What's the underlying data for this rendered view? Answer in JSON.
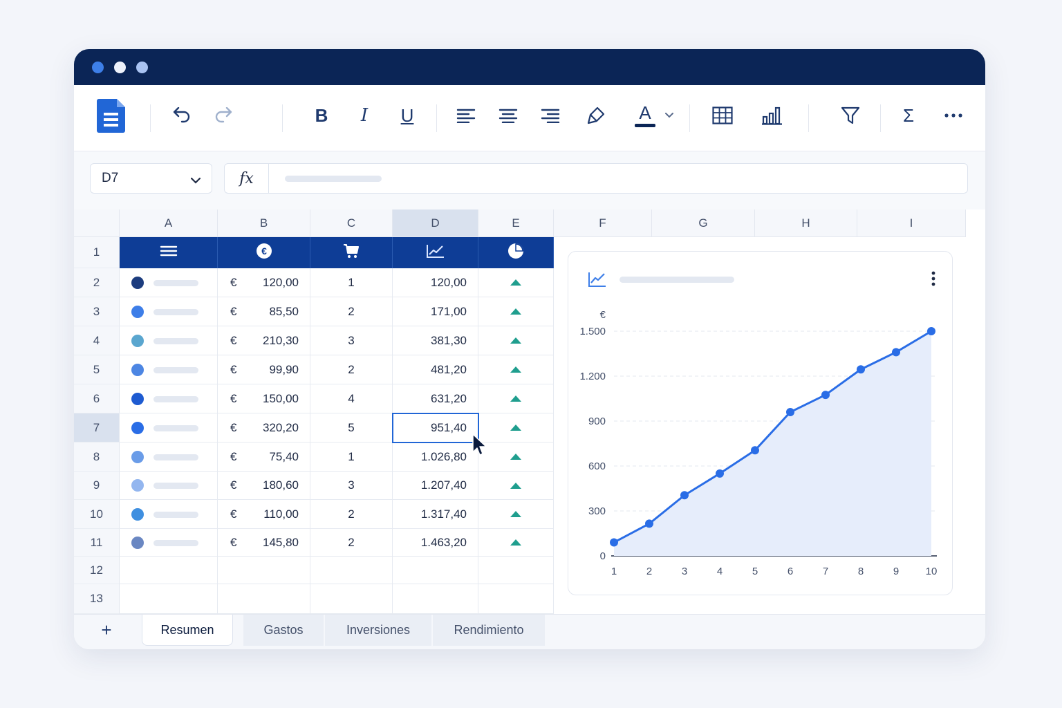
{
  "namebox": {
    "value": "D7"
  },
  "formula": {
    "label": "fx"
  },
  "toolbar": {
    "bold": "B",
    "italic": "I",
    "underline": "U",
    "font_color": "A",
    "sum": "Σ"
  },
  "columns": [
    "A",
    "B",
    "C",
    "D",
    "E",
    "F",
    "G",
    "H",
    "I"
  ],
  "rows": [
    "1",
    "2",
    "3",
    "4",
    "5",
    "6",
    "7",
    "8",
    "9",
    "10",
    "11",
    "12",
    "13"
  ],
  "header_icons": [
    "menu-icon",
    "euro-icon",
    "cart-icon",
    "trend-icon",
    "pie-icon"
  ],
  "table": [
    {
      "dot_color": "#1c3c7e",
      "currency": "€",
      "price": "120,00",
      "qty": "1",
      "total": "120,00"
    },
    {
      "dot_color": "#3d7ee8",
      "currency": "€",
      "price": "85,50",
      "qty": "2",
      "total": "171,00"
    },
    {
      "dot_color": "#5aa6cf",
      "currency": "€",
      "price": "210,30",
      "qty": "3",
      "total": "381,30"
    },
    {
      "dot_color": "#4d86e3",
      "currency": "€",
      "price": "99,90",
      "qty": "2",
      "total": "481,20"
    },
    {
      "dot_color": "#1e5bd1",
      "currency": "€",
      "price": "150,00",
      "qty": "4",
      "total": "631,20"
    },
    {
      "dot_color": "#2a6de6",
      "currency": "€",
      "price": "320,20",
      "qty": "5",
      "total": "951,40"
    },
    {
      "dot_color": "#6a9ce8",
      "currency": "€",
      "price": "75,40",
      "qty": "1",
      "total": "1.026,80"
    },
    {
      "dot_color": "#93b6ef",
      "currency": "€",
      "price": "180,60",
      "qty": "3",
      "total": "1.207,40"
    },
    {
      "dot_color": "#3f8fe0",
      "currency": "€",
      "price": "110,00",
      "qty": "2",
      "total": "1.317,40"
    },
    {
      "dot_color": "#6a87c2",
      "currency": "€",
      "price": "145,80",
      "qty": "2",
      "total": "1.463,20"
    }
  ],
  "selected_cell": "D7",
  "chart_data": {
    "type": "area",
    "title": "",
    "ylabel": "€",
    "xlabel": "",
    "x": [
      1,
      2,
      3,
      4,
      5,
      6,
      7,
      8,
      9,
      10
    ],
    "x_tick_labels": [
      "1",
      "2",
      "3",
      "4",
      "5",
      "6",
      "7",
      "8",
      "9",
      "10"
    ],
    "y_tick_labels": [
      "0",
      "300",
      "600",
      "900",
      "1.200",
      "1.500"
    ],
    "y_ticks": [
      0,
      300,
      600,
      900,
      1200,
      1500
    ],
    "ylim": [
      0,
      1500
    ],
    "series": [
      {
        "values": [
          90,
          215,
          405,
          550,
          705,
          960,
          1075,
          1245,
          1360,
          1500
        ]
      }
    ],
    "grid": "horizontal dashed",
    "legend": "none"
  },
  "colors": {
    "accent": "#2166d6",
    "header": "#0e3d96",
    "titlebar": "#0b2556",
    "up_arrow": "#1f9e8e",
    "line": "#2a6de6"
  },
  "sheet_tabs": [
    "Resumen",
    "Gastos",
    "Inversiones",
    "Rendimiento"
  ],
  "active_tab": "Resumen"
}
